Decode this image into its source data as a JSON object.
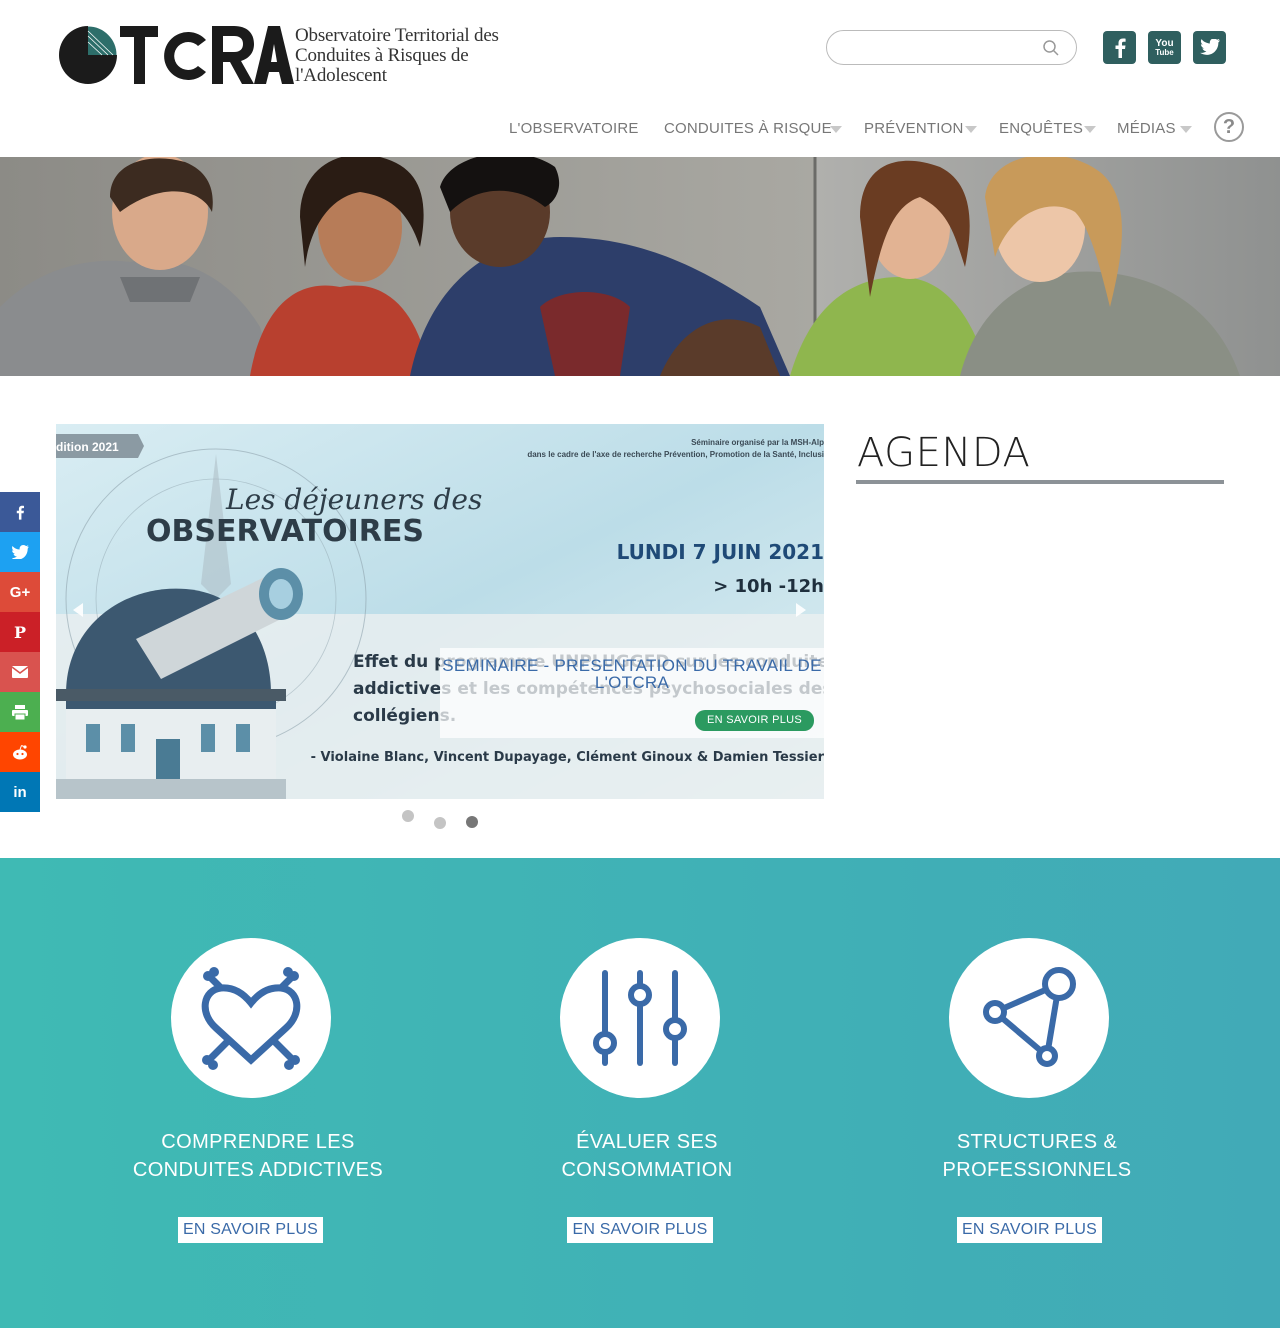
{
  "header": {
    "logo": {
      "wordmark": "OTCRA",
      "tagline_lines": [
        "Observatoire Territorial des",
        "Conduites à Risques de",
        "l'Adolescent"
      ]
    },
    "search": {
      "value": "",
      "placeholder": ""
    },
    "social": [
      {
        "icon": "facebook-icon"
      },
      {
        "icon": "youtube-icon",
        "label_top": "You",
        "label_bottom": "Tube"
      },
      {
        "icon": "twitter-icon"
      }
    ],
    "colors": {
      "social_bg": "#2f5f5f"
    }
  },
  "nav": {
    "items": [
      {
        "label": "L'OBSERVATOIRE",
        "has_dropdown": false
      },
      {
        "label": "CONDUITES À RISQUE",
        "has_dropdown": true
      },
      {
        "label": "PRÉVENTION",
        "has_dropdown": true
      },
      {
        "label": "ENQUÊTES",
        "has_dropdown": true
      },
      {
        "label": "MÉDIAS",
        "has_dropdown": true
      }
    ],
    "help_icon": "question-icon",
    "help_glyph": "?"
  },
  "slider": {
    "image": {
      "edition": "dition 2021",
      "org_line1": "Séminaire organisé par la MSH-Alp",
      "org_line2": "dans le cadre de l'axe de recherche Prévention, Promotion de la Santé, Inclusi",
      "script_title": "Les déjeuners des",
      "title": "OBSERVATOIRES",
      "date": "LUNDI 7 JUIN 2021",
      "time": "> 10h -12h",
      "talk_line1": "Effet du programme UNPLUGGED sur les conduites",
      "talk_line2": "addictives et les compétences psychosociales des",
      "talk_line3": "collégiens.",
      "authors": "- Violaine Blanc, Vincent Dupayage, Clément Ginoux & Damien Tessier"
    },
    "caption_title": "SEMINAIRE - PRESENTATION DU TRAVAIL DE L'OTCRA",
    "button": "EN SAVOIR PLUS",
    "active_dot": 3,
    "dot_count": 3,
    "colors": {
      "button": "#2b9a60",
      "caption_text": "#3a6aa8"
    }
  },
  "agenda": {
    "title": "AGENDA"
  },
  "share_bar": [
    {
      "icon": "facebook-share-icon",
      "color": "#3b5998"
    },
    {
      "icon": "twitter-share-icon",
      "color": "#1da1f2"
    },
    {
      "icon": "google-plus-share-icon",
      "color": "#dd4b39"
    },
    {
      "icon": "pinterest-share-icon",
      "color": "#cb2027"
    },
    {
      "icon": "email-share-icon",
      "color": "#d9534f"
    },
    {
      "icon": "print-share-icon",
      "color": "#4caf50"
    },
    {
      "icon": "reddit-share-icon",
      "color": "#ff4500"
    },
    {
      "icon": "linkedin-share-icon",
      "color": "#0077b5"
    }
  ],
  "features": [
    {
      "icon": "heart-crossbones-icon",
      "title_lines": [
        "COMPRENDRE LES",
        "CONDUITES ADDICTIVES"
      ],
      "button": "EN SAVOIR PLUS"
    },
    {
      "icon": "sliders-icon",
      "title_lines": [
        "ÉVALUER SES",
        "CONSOMMATION"
      ],
      "button": "EN SAVOIR PLUS"
    },
    {
      "icon": "network-icon",
      "title_lines": [
        "STRUCTURES &",
        "PROFESSIONNELS"
      ],
      "button": "EN SAVOIR PLUS"
    }
  ],
  "colors": {
    "teal_start": "#3fbab4",
    "teal_end": "#41aab7",
    "icon_blue": "#3a6aa8"
  }
}
